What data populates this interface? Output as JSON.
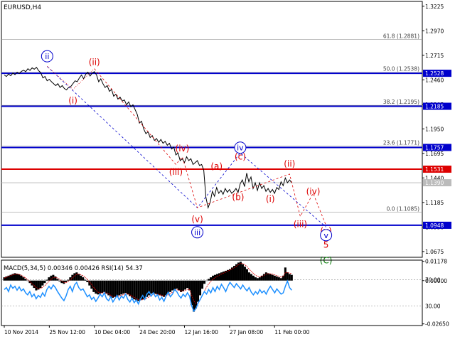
{
  "chart_data": [
    {
      "type": "line",
      "panel": "price",
      "title": "EURUSD,H4",
      "x_tick_labels": [
        "10 Nov 2014",
        "25 Nov 12:00",
        "10 Dec 04:00",
        "24 Dec 20:00",
        "12 Jan 16:00",
        "27 Jan 08:00",
        "11 Feb 00:00"
      ],
      "ylim": [
        1.0615,
        1.3275
      ],
      "y_tick_labels": [
        "1.3225",
        "1.2970",
        "1.2715",
        "1.2460",
        "1.2205",
        "1.1950",
        "1.1695",
        "1.1440",
        "1.1185",
        "1.0930",
        "1.0675"
      ],
      "y_tick_values": [
        1.3225,
        1.297,
        1.2715,
        1.246,
        1.2205,
        1.195,
        1.1695,
        1.144,
        1.1185,
        1.093,
        1.0675
      ],
      "series": [
        {
          "values": [
            1.251,
            1.2495,
            1.252,
            1.2502,
            1.253,
            1.2515,
            1.254,
            1.2525,
            1.2548,
            1.256,
            1.2545,
            1.2575,
            1.2558,
            1.2585,
            1.257,
            1.259,
            1.2555,
            1.2535,
            1.248,
            1.2495,
            1.245,
            1.2465,
            1.244,
            1.242,
            1.24,
            1.242,
            1.238,
            1.24,
            1.237,
            1.2355,
            1.238,
            1.239,
            1.242,
            1.245,
            1.244,
            1.248,
            1.251,
            1.247,
            1.252,
            1.254,
            1.25,
            1.253,
            1.2545,
            1.251,
            1.244,
            1.247,
            1.242,
            1.238,
            1.24,
            1.234,
            1.236,
            1.229,
            1.231,
            1.226,
            1.228,
            1.224,
            1.225,
            1.22,
            1.223,
            1.218,
            1.22,
            1.215,
            1.21,
            1.201,
            1.203,
            1.195,
            1.19,
            1.192,
            1.186,
            1.188,
            1.183,
            1.185,
            1.181,
            1.184,
            1.18,
            1.182,
            1.178,
            1.18,
            1.174,
            1.176,
            1.168,
            1.17,
            1.162,
            1.164,
            1.16,
            1.166,
            1.162,
            1.164,
            1.158,
            1.16,
            1.162,
            1.157,
            1.158,
            1.152,
            1.124,
            1.113,
            1.119,
            1.13,
            1.125,
            1.134,
            1.128,
            1.131,
            1.127,
            1.133,
            1.129,
            1.132,
            1.128,
            1.13,
            1.133,
            1.129,
            1.138,
            1.142,
            1.135,
            1.149,
            1.14,
            1.145,
            1.133,
            1.139,
            1.131,
            1.139,
            1.133,
            1.136,
            1.13,
            1.133,
            1.129,
            1.132,
            1.128,
            1.134,
            1.132,
            1.14,
            1.136,
            1.144,
            1.139,
            1.142,
            1.139
          ]
        }
      ],
      "horizontal_levels": [
        {
          "label": "1.2528",
          "value": 1.2528,
          "color": "#0000cc"
        },
        {
          "label": "1.2185",
          "value": 1.2185,
          "color": "#0000cc"
        },
        {
          "label": "1.1757",
          "value": 1.1757,
          "color": "#0000cc"
        },
        {
          "label": "1.1531",
          "value": 1.1531,
          "color": "#dd0000"
        },
        {
          "label": "1.1390",
          "value": 1.139,
          "color": "#bbbbbb"
        },
        {
          "label": "1.0948",
          "value": 1.0948,
          "color": "#0000cc"
        }
      ],
      "fibonacci_levels": [
        {
          "label": "61.8 (1.2881)",
          "value": 1.2881
        },
        {
          "label": "50.0 (1.2538)",
          "value": 1.2538
        },
        {
          "label": "38.2 (1.2195)",
          "value": 1.2195
        },
        {
          "label": "23.6 (1.1771)",
          "value": 1.1771
        },
        {
          "label": "0.0 (1.1085)",
          "value": 1.1085
        }
      ],
      "wave_labels": [
        {
          "text": "ii",
          "style": "circle",
          "color": "#0000cc",
          "bar": 20,
          "value": 1.2705
        },
        {
          "text": "(ii)",
          "style": "plain",
          "color": "#dd0000",
          "bar": 42,
          "value": 1.2645
        },
        {
          "text": "(i)",
          "style": "plain",
          "color": "#dd0000",
          "bar": 32,
          "value": 1.2245
        },
        {
          "text": "(iv)",
          "style": "plain",
          "color": "#dd0000",
          "bar": 83,
          "value": 1.1745
        },
        {
          "text": "(iii)",
          "style": "plain",
          "color": "#dd0000",
          "bar": 80,
          "value": 1.15
        },
        {
          "text": "(a)",
          "style": "plain",
          "color": "#dd0000",
          "bar": 99,
          "value": 1.156
        },
        {
          "text": "iv",
          "style": "circle",
          "color": "#0000cc",
          "bar": 110,
          "value": 1.1755
        },
        {
          "text": "(c)",
          "style": "plain",
          "color": "#dd0000",
          "bar": 110,
          "value": 1.166
        },
        {
          "text": "(ii)",
          "style": "plain",
          "color": "#dd0000",
          "bar": 133,
          "value": 1.1585
        },
        {
          "text": "(b)",
          "style": "plain",
          "color": "#dd0000",
          "bar": 109,
          "value": 1.124
        },
        {
          "text": "(v)",
          "style": "plain",
          "color": "#dd0000",
          "bar": 90,
          "value": 1.101
        },
        {
          "text": "iii",
          "style": "circle",
          "color": "#0000cc",
          "bar": 90,
          "value": 1.0875
        },
        {
          "text": "(i)",
          "style": "plain",
          "color": "#dd0000",
          "bar": 124,
          "value": 1.122
        },
        {
          "text": "(iv)",
          "style": "plain",
          "color": "#dd0000",
          "bar": 144,
          "value": 1.13
        },
        {
          "text": "(iii)",
          "style": "plain",
          "color": "#dd0000",
          "bar": 138,
          "value": 1.096
        },
        {
          "text": "(v)",
          "style": "plain",
          "color": "#dd0000",
          "bar": 150,
          "value": 1.089
        },
        {
          "text": "v",
          "style": "circle",
          "color": "#0000cc",
          "bar": 150,
          "value": 1.0845
        },
        {
          "text": "5",
          "style": "plain",
          "color": "#dd0000",
          "bar": 150,
          "value": 1.0745
        },
        {
          "text": "(C)",
          "style": "plain",
          "color": "#007700",
          "bar": 150,
          "value": 1.058
        }
      ],
      "wave_paths": [
        {
          "color": "#0000cc",
          "style": "dashed",
          "points": [
            [
              20,
              1.26
            ],
            [
              90,
              1.113
            ],
            [
              110,
              1.17
            ],
            [
              150,
              1.093
            ]
          ]
        },
        {
          "color": "#dd0000",
          "style": "dashed",
          "points": [
            [
              42,
              1.2575
            ],
            [
              80,
              1.158
            ],
            [
              83,
              1.166
            ],
            [
              90,
              1.113
            ],
            [
              133,
              1.148
            ],
            [
              138,
              1.104
            ],
            [
              144,
              1.128
            ],
            [
              150,
              1.0945
            ]
          ]
        },
        {
          "color": "#dd0000",
          "style": "dotted",
          "points": [
            [
              20,
              1.26
            ],
            [
              32,
              1.236
            ],
            [
              42,
              1.2575
            ]
          ]
        }
      ]
    },
    {
      "type": "line",
      "panel": "indicator",
      "title": "MACD(5,34,5) 0.00346 0.00426 RSI(14) 54.37",
      "right_tick_labels": [
        "0.01178",
        "0.00000",
        "-0.02650"
      ],
      "right_tick_values": [
        0.01178,
        0.0,
        -0.0265
      ],
      "left_tick_labels": [
        "70.00",
        "30.00"
      ],
      "left_tick_values": [
        70,
        30
      ],
      "macd_histogram": [
        0.002,
        0.0025,
        0.003,
        0.0035,
        0.004,
        0.0045,
        0.0042,
        0.0038,
        0.003,
        0.002,
        0.001,
        0.0,
        -0.0015,
        -0.003,
        -0.0045,
        -0.006,
        -0.0055,
        -0.0045,
        -0.003,
        -0.0015,
        0.0005,
        0.002,
        0.003,
        0.0035,
        0.0025,
        0.001,
        -0.0005,
        -0.0015,
        -0.002,
        -0.001,
        0.0005,
        0.002,
        0.0035,
        0.0045,
        0.005,
        0.004,
        0.003,
        0.002,
        0.0005,
        -0.001,
        -0.003,
        -0.005,
        -0.007,
        -0.008,
        -0.0085,
        -0.008,
        -0.0075,
        -0.007,
        -0.008,
        -0.009,
        -0.01,
        -0.0105,
        -0.01,
        -0.0095,
        -0.009,
        -0.0085,
        -0.008,
        -0.0075,
        -0.0085,
        -0.0095,
        -0.0105,
        -0.0115,
        -0.012,
        -0.0125,
        -0.012,
        -0.0115,
        -0.011,
        -0.01,
        -0.009,
        -0.008,
        -0.0075,
        -0.008,
        -0.0085,
        -0.009,
        -0.0095,
        -0.01,
        -0.009,
        -0.008,
        -0.007,
        -0.006,
        -0.0055,
        -0.005,
        -0.006,
        -0.007,
        -0.0065,
        -0.0055,
        -0.0045,
        -0.006,
        -0.015,
        -0.019,
        -0.017,
        -0.013,
        -0.009,
        -0.005,
        -0.002,
        0.0,
        0.001,
        0.002,
        0.003,
        0.0035,
        0.004,
        0.0045,
        0.005,
        0.0055,
        0.006,
        0.0065,
        0.007,
        0.008,
        0.009,
        0.01,
        0.011,
        0.0115,
        0.01,
        0.0085,
        0.007,
        0.005,
        0.004,
        0.003,
        0.002,
        0.0015,
        0.002,
        0.003,
        0.004,
        0.005,
        0.0045,
        0.004,
        0.0035,
        0.003,
        0.0025,
        0.002,
        0.0015,
        0.003,
        0.008,
        0.005,
        0.004,
        0.0035
      ],
      "macd_signal": [
        0.0015,
        0.002,
        0.0025,
        0.003,
        0.0035,
        0.0038,
        0.004,
        0.0038,
        0.0033,
        0.0025,
        0.0016,
        0.0006,
        -0.0005,
        -0.0018,
        -0.003,
        -0.0042,
        -0.0048,
        -0.0048,
        -0.0042,
        -0.0032,
        -0.0018,
        -0.0004,
        0.0008,
        0.0018,
        0.002,
        0.0016,
        0.0008,
        -0.0002,
        -0.001,
        -0.0012,
        -0.0006,
        0.0004,
        0.0016,
        0.0028,
        0.0038,
        0.004,
        0.0036,
        0.003,
        0.002,
        0.0008,
        -0.0008,
        -0.0024,
        -0.0042,
        -0.0058,
        -0.007,
        -0.0076,
        -0.0076,
        -0.0074,
        -0.0076,
        -0.0082,
        -0.009,
        -0.0097,
        -0.0099,
        -0.0097,
        -0.0094,
        -0.009,
        -0.0086,
        -0.0081,
        -0.0082,
        -0.0087,
        -0.0094,
        -0.0103,
        -0.011,
        -0.0116,
        -0.0118,
        -0.0117,
        -0.0114,
        -0.0108,
        -0.01,
        -0.0091,
        -0.0084,
        -0.0082,
        -0.0083,
        -0.0086,
        -0.009,
        -0.0095,
        -0.0093,
        -0.0088,
        -0.008,
        -0.0071,
        -0.0063,
        -0.0056,
        -0.0058,
        -0.0063,
        -0.0064,
        -0.006,
        -0.0053,
        -0.0056,
        -0.009,
        -0.0125,
        -0.014,
        -0.0136,
        -0.0118,
        -0.0093,
        -0.0065,
        -0.004,
        -0.002,
        -0.0005,
        0.0008,
        0.0018,
        0.0026,
        0.0033,
        0.004,
        0.0046,
        0.0052,
        0.0058,
        0.0064,
        0.0071,
        0.0079,
        0.0088,
        0.0097,
        0.0105,
        0.0104,
        0.0097,
        0.0086,
        0.007,
        0.0056,
        0.0044,
        0.0033,
        0.0025,
        0.0023,
        0.0026,
        0.0032,
        0.004,
        0.0042,
        0.0041,
        0.0039,
        0.0035,
        0.0031,
        0.0026,
        0.0021,
        0.0025,
        0.005,
        0.005,
        0.0045,
        0.0043
      ],
      "rsi": [
        55,
        58,
        52,
        62,
        57,
        60,
        54,
        59,
        53,
        56,
        50,
        47,
        52,
        44,
        48,
        41,
        46,
        43,
        50,
        45,
        55,
        60,
        56,
        62,
        58,
        52,
        47,
        42,
        38,
        45,
        55,
        60,
        52,
        62,
        66,
        58,
        54,
        56,
        50,
        44,
        47,
        40,
        43,
        37,
        42,
        48,
        44,
        50,
        41,
        38,
        44,
        36,
        41,
        46,
        39,
        45,
        42,
        48,
        40,
        36,
        42,
        35,
        39,
        33,
        41,
        46,
        40,
        48,
        52,
        45,
        50,
        44,
        47,
        39,
        43,
        37,
        45,
        51,
        44,
        48,
        55,
        52,
        46,
        42,
        48,
        44,
        50,
        45,
        30,
        22,
        26,
        34,
        40,
        46,
        52,
        48,
        55,
        50,
        58,
        52,
        60,
        55,
        63,
        58,
        52,
        60,
        66,
        62,
        58,
        64,
        60,
        56,
        62,
        57,
        53,
        58,
        51,
        47,
        52,
        48,
        55,
        50,
        53,
        48,
        55,
        60,
        55,
        50,
        56,
        52,
        48,
        50,
        60,
        68,
        58,
        54
      ],
      "rsi_ylim": [
        0,
        100
      ],
      "macd_ylim": [
        -0.0275,
        0.0125
      ]
    }
  ],
  "colors": {
    "background": "#ffffff",
    "price_line": "#000000",
    "blue_level": "#0000cc",
    "red_level": "#dd0000",
    "grey_level": "#bbbbbb",
    "fib_line": "#999999",
    "rsi_line": "#1e90ff",
    "macd_hist": "#000000",
    "macd_signal": "#dd0000",
    "axis_label_bg_blue": "#0000cc",
    "axis_label_bg_red": "#dd0000",
    "axis_label_bg_grey": "#bbbbbb"
  }
}
